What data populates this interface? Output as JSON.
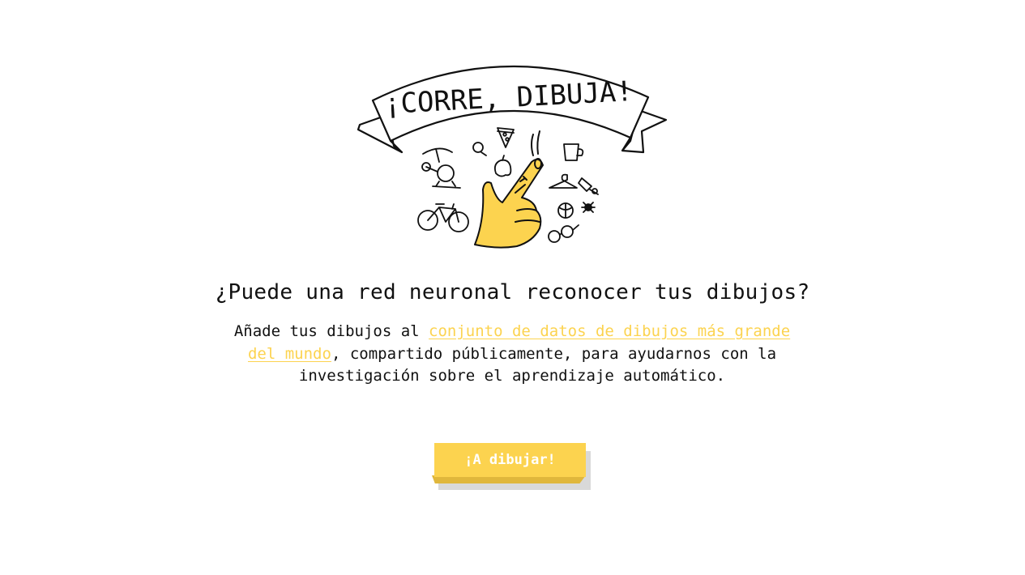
{
  "logo": {
    "banner_text": "¡CORRE, DIBUJA!",
    "accent_color": "#fcd34f",
    "icons": [
      "helicopter-icon",
      "bulb-icon",
      "pizza-icon",
      "apple-icon",
      "mug-icon",
      "hanger-icon",
      "pushpin-icon",
      "bicycle-icon",
      "basketball-icon",
      "spider-icon",
      "glasses-icon",
      "pointing-hand-icon"
    ]
  },
  "headline": "¿Puede una red neuronal reconocer tus dibujos?",
  "intro": {
    "before_link": "Añade tus dibujos al ",
    "link_text": "conjunto de datos de dibujos más grande del mundo",
    "after_link": ", compartido públicamente, para ayudarnos con la investigación sobre el aprendizaje automático."
  },
  "cta": {
    "label": "¡A dibujar!"
  }
}
